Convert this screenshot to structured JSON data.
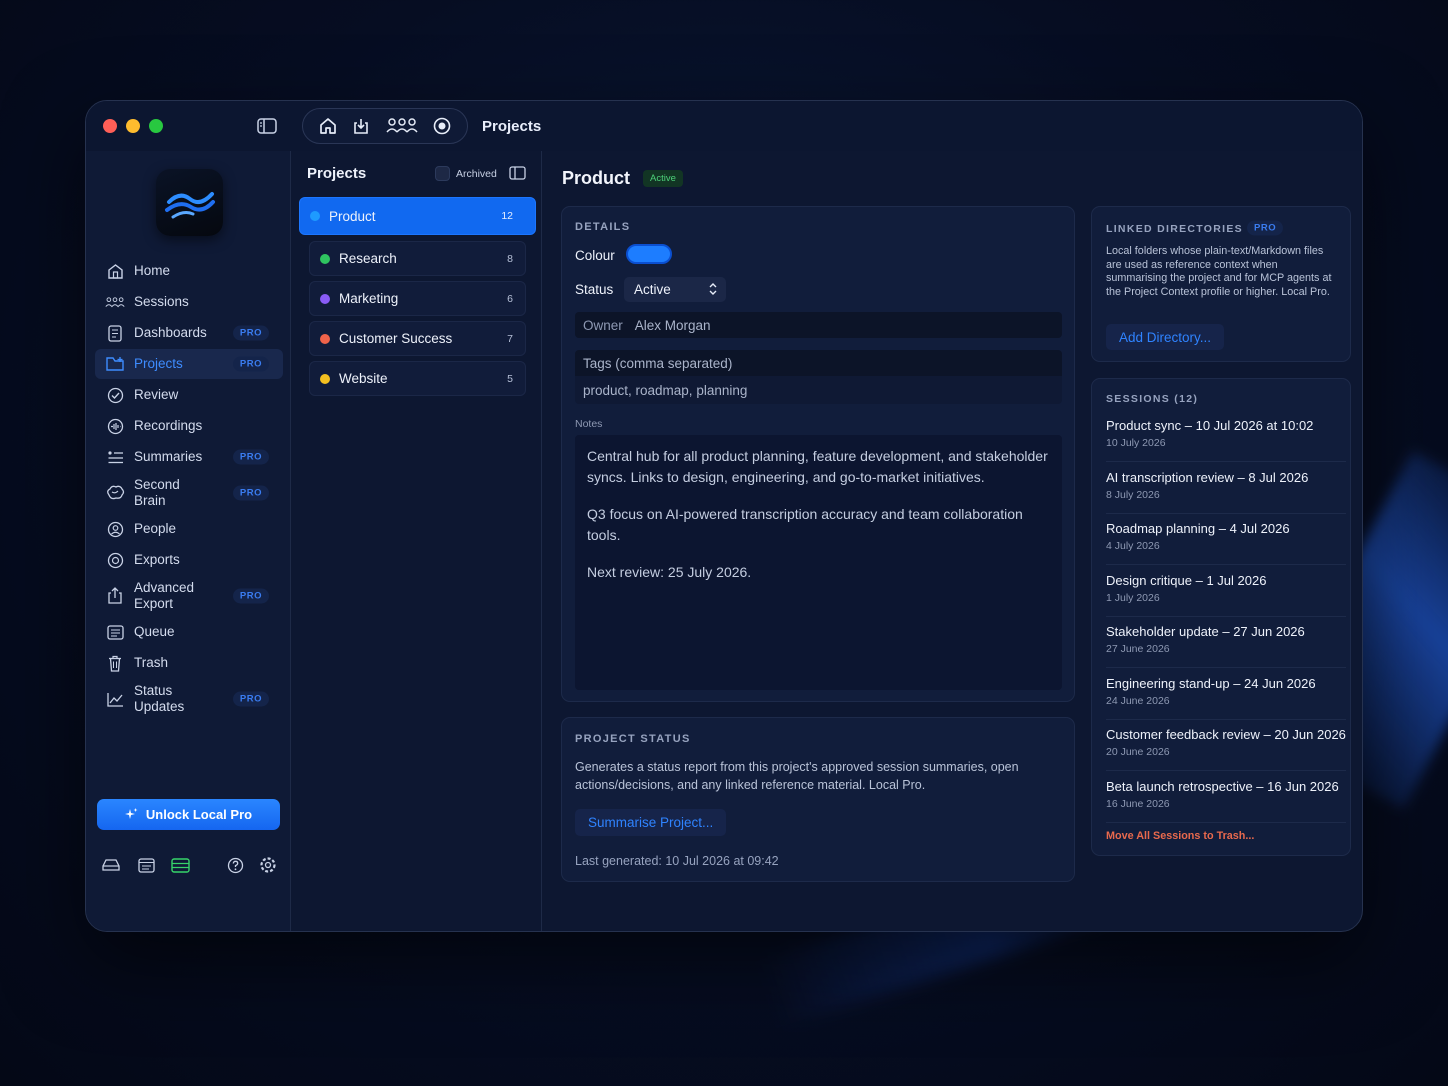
{
  "window": {
    "title": "Projects"
  },
  "sidebar": {
    "items": [
      {
        "label": "Home",
        "icon": "home-icon",
        "pro": ""
      },
      {
        "label": "Sessions",
        "icon": "sessions-icon",
        "pro": ""
      },
      {
        "label": "Dashboards",
        "icon": "dashboards-icon",
        "pro": "PRO"
      },
      {
        "label": "Projects",
        "icon": "projects-icon",
        "pro": "PRO"
      },
      {
        "label": "Review",
        "icon": "review-icon",
        "pro": ""
      },
      {
        "label": "Recordings",
        "icon": "recordings-icon",
        "pro": ""
      },
      {
        "label": "Summaries",
        "icon": "summaries-icon",
        "pro": "PRO"
      },
      {
        "label": "Second Brain",
        "icon": "brain-icon",
        "pro": "PRO"
      },
      {
        "label": "People",
        "icon": "people-icon",
        "pro": ""
      },
      {
        "label": "Exports",
        "icon": "exports-icon",
        "pro": ""
      },
      {
        "label": "Advanced Export",
        "icon": "advanced-export-icon",
        "pro": "PRO"
      },
      {
        "label": "Queue",
        "icon": "queue-icon",
        "pro": ""
      },
      {
        "label": "Trash",
        "icon": "trash-icon",
        "pro": ""
      },
      {
        "label": "Status Updates",
        "icon": "status-updates-icon",
        "pro": "PRO"
      }
    ],
    "unlock_label": "Unlock Local Pro"
  },
  "projects_pane": {
    "title": "Projects",
    "archived_label": "Archived",
    "projects": [
      {
        "name": "Product",
        "count": "12",
        "color": "#1e9bff"
      },
      {
        "name": "Research",
        "count": "8",
        "color": "#2fc460"
      },
      {
        "name": "Marketing",
        "count": "6",
        "color": "#8a5cf6"
      },
      {
        "name": "Customer Success",
        "count": "7",
        "color": "#f0634a"
      },
      {
        "name": "Website",
        "count": "5",
        "color": "#f4c020"
      }
    ]
  },
  "detail": {
    "title": "Product",
    "status_badge": "Active",
    "details_title": "DETAILS",
    "colour_label": "Colour",
    "colour_value": "#1d7dff",
    "status_label": "Status",
    "status_value": "Active",
    "owner_label": "Owner",
    "owner_value": "Alex Morgan",
    "tags_label": "Tags (comma separated)",
    "tags_value": "product, roadmap, planning",
    "notes_label": "Notes",
    "notes": [
      "Central hub for all product planning, feature development, and stakeholder syncs. Links to design, engineering, and go-to-market initiatives.",
      "Q3 focus on AI-powered transcription accuracy and team collaboration tools.",
      "Next review: 25 July 2026."
    ]
  },
  "project_status": {
    "title": "PROJECT STATUS",
    "description": "Generates a status report from this project's approved session summaries, open actions/decisions, and any linked reference material. Local Pro.",
    "button": "Summarise Project...",
    "last_generated": "Last generated: 10 Jul 2026 at 09:42"
  },
  "linked_directories": {
    "title": "LINKED DIRECTORIES",
    "pro": "PRO",
    "description": "Local folders whose plain-text/Markdown files are used as reference context when summarising the project and for MCP agents at the Project Context profile or higher. Local Pro.",
    "button": "Add Directory..."
  },
  "sessions": {
    "title": "SESSIONS (12)",
    "items": [
      {
        "title": "Product sync – 10 Jul 2026 at 10:02",
        "date": "10 July 2026"
      },
      {
        "title": "AI transcription review – 8 Jul 2026",
        "date": "8 July 2026"
      },
      {
        "title": "Roadmap planning – 4 Jul 2026",
        "date": "4 July 2026"
      },
      {
        "title": "Design critique – 1 Jul 2026",
        "date": "1 July 2026"
      },
      {
        "title": "Stakeholder update – 27 Jun 2026",
        "date": "27 June 2026"
      },
      {
        "title": "Engineering stand-up – 24 Jun 2026",
        "date": "24 June 2026"
      },
      {
        "title": "Customer feedback review – 20 Jun 2026",
        "date": "20 June 2026"
      },
      {
        "title": "Beta launch retrospective – 16 Jun 2026",
        "date": "16 June 2026"
      }
    ],
    "move_all": "Move All Sessions to Trash..."
  }
}
